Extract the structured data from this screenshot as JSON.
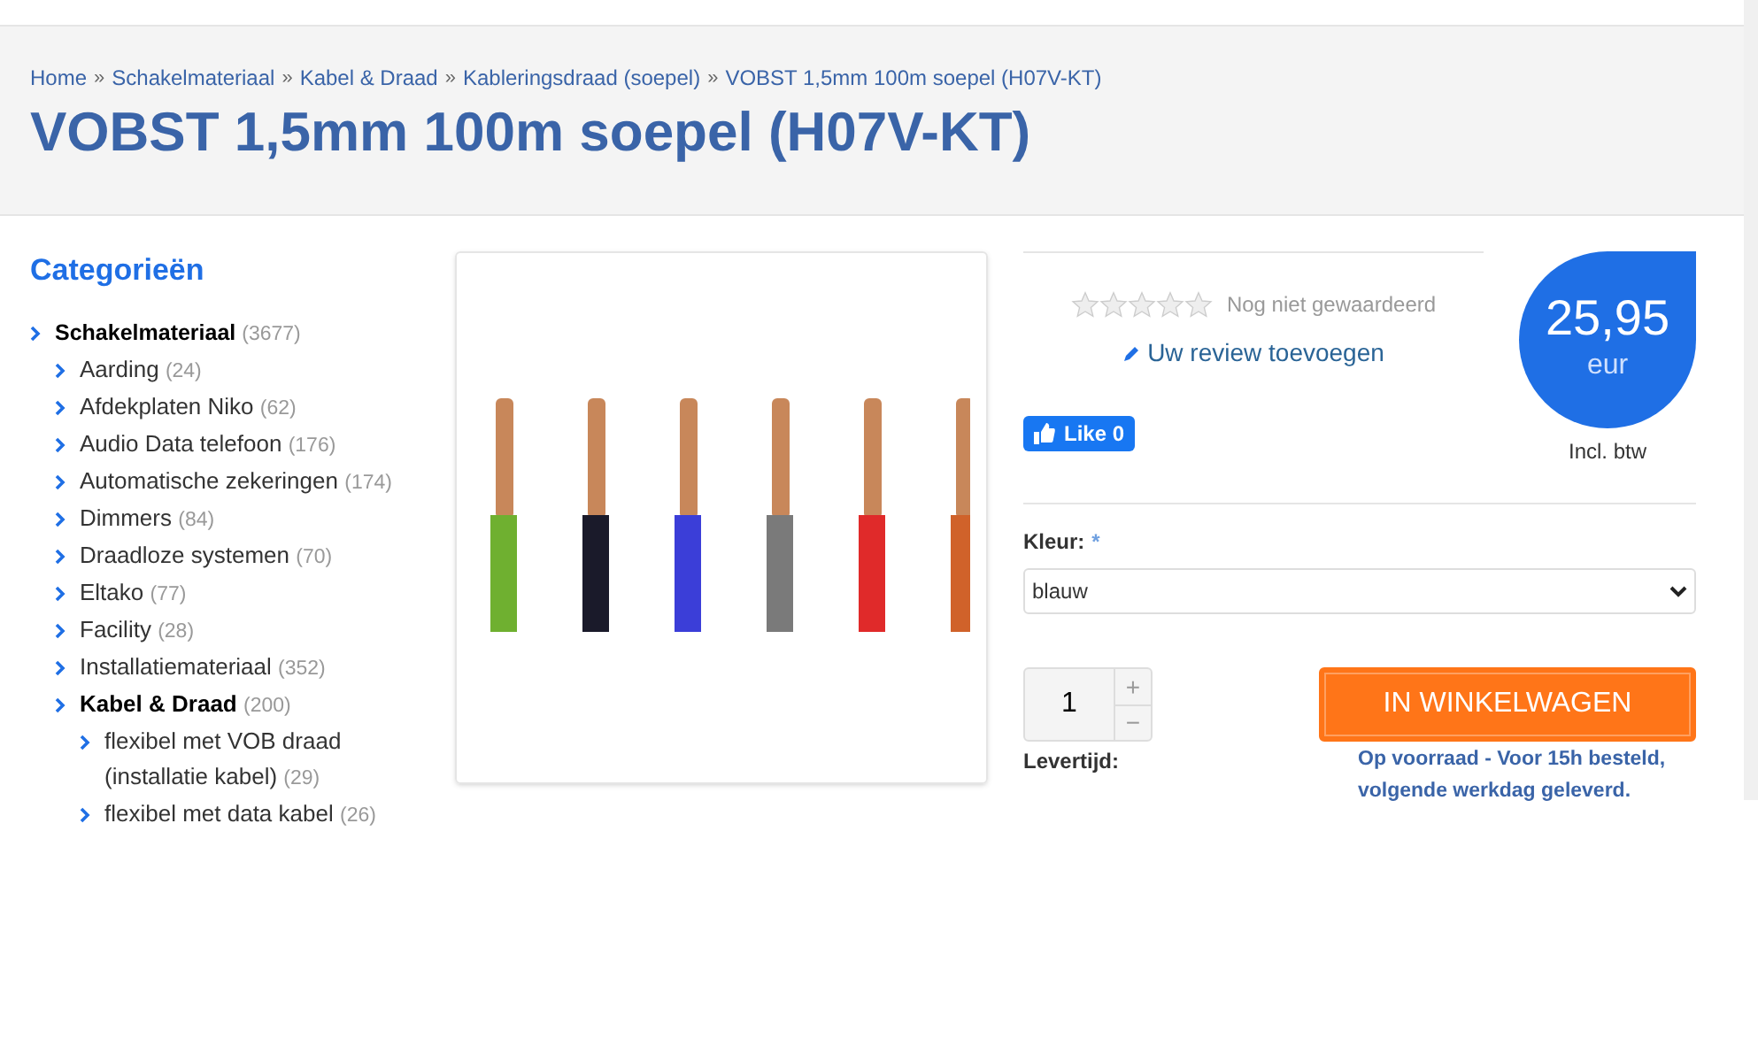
{
  "breadcrumb": [
    "Home",
    "Schakelmateriaal",
    "Kabel & Draad",
    "Kableringsdraad (soepel)",
    "VOBST 1,5mm 100m soepel (H07V-KT)"
  ],
  "breadcrumb_separator": "»",
  "title": "VOBST 1,5mm 100m soepel (H07V-KT)",
  "sidebar": {
    "heading": "Categorieën",
    "items": [
      {
        "label": "Schakelmateriaal",
        "count": "(3677)",
        "active": true,
        "children": [
          {
            "label": "Aarding",
            "count": "(24)",
            "active": false
          },
          {
            "label": "Afdekplaten Niko",
            "count": "(62)",
            "active": false
          },
          {
            "label": "Audio Data telefoon",
            "count": "(176)",
            "active": false
          },
          {
            "label": "Automatische zekeringen",
            "count": "(174)",
            "active": false
          },
          {
            "label": "Dimmers",
            "count": "(84)",
            "active": false
          },
          {
            "label": "Draadloze systemen",
            "count": "(70)",
            "active": false
          },
          {
            "label": "Eltako",
            "count": "(77)",
            "active": false
          },
          {
            "label": "Facility",
            "count": "(28)",
            "active": false
          },
          {
            "label": "Installatiemateriaal",
            "count": "(352)",
            "active": false
          },
          {
            "label": "Kabel & Draad",
            "count": "(200)",
            "active": true,
            "children": [
              {
                "label": "flexibel met VOB draad (installatie kabel)",
                "count": "(29)",
                "active": false
              },
              {
                "label": "flexibel met data kabel",
                "count": "(26)",
                "active": false
              }
            ]
          }
        ]
      }
    ]
  },
  "rating": {
    "stars": 0,
    "text": "Nog niet gewaardeerd",
    "review_link": "Uw review toevoegen"
  },
  "like_button": "Like 0",
  "price": {
    "amount": "25,95",
    "currency": "eur",
    "note": "Incl. btw"
  },
  "color_field": {
    "label": "Kleur:",
    "required_mark": "*",
    "value": "blauw"
  },
  "quantity": {
    "value": "1",
    "plus": "+",
    "minus": "−"
  },
  "cart_button": "IN WINKELWAGEN",
  "delivery": {
    "label": "Levertijd:",
    "text": "Op voorraad - Voor 15h besteld, volgende werkdag geleverd."
  }
}
